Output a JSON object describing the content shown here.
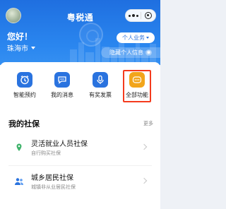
{
  "header": {
    "title": "粤税通",
    "greeting": "您好！",
    "city": "珠海市",
    "biz_button": "个人业务",
    "hide_button": "隐藏个人信息",
    "accent_color": "#2a86ef"
  },
  "quick_actions": [
    {
      "label": "智能预约",
      "icon": "alarm-clock-icon"
    },
    {
      "label": "我的消息",
      "icon": "chat-bubble-icon"
    },
    {
      "label": "有奖发票",
      "icon": "microphone-icon"
    },
    {
      "label": "全部功能",
      "icon": "more-dots-icon",
      "highlighted": true
    }
  ],
  "section": {
    "title": "我的社保",
    "more": "更多"
  },
  "social_security": [
    {
      "title": "灵活就业人员社保",
      "subtitle": "自行购买社保",
      "icon": "pin-icon"
    },
    {
      "title": "城乡居民社保",
      "subtitle": "城镇非从业居民社保",
      "icon": "users-icon"
    }
  ]
}
